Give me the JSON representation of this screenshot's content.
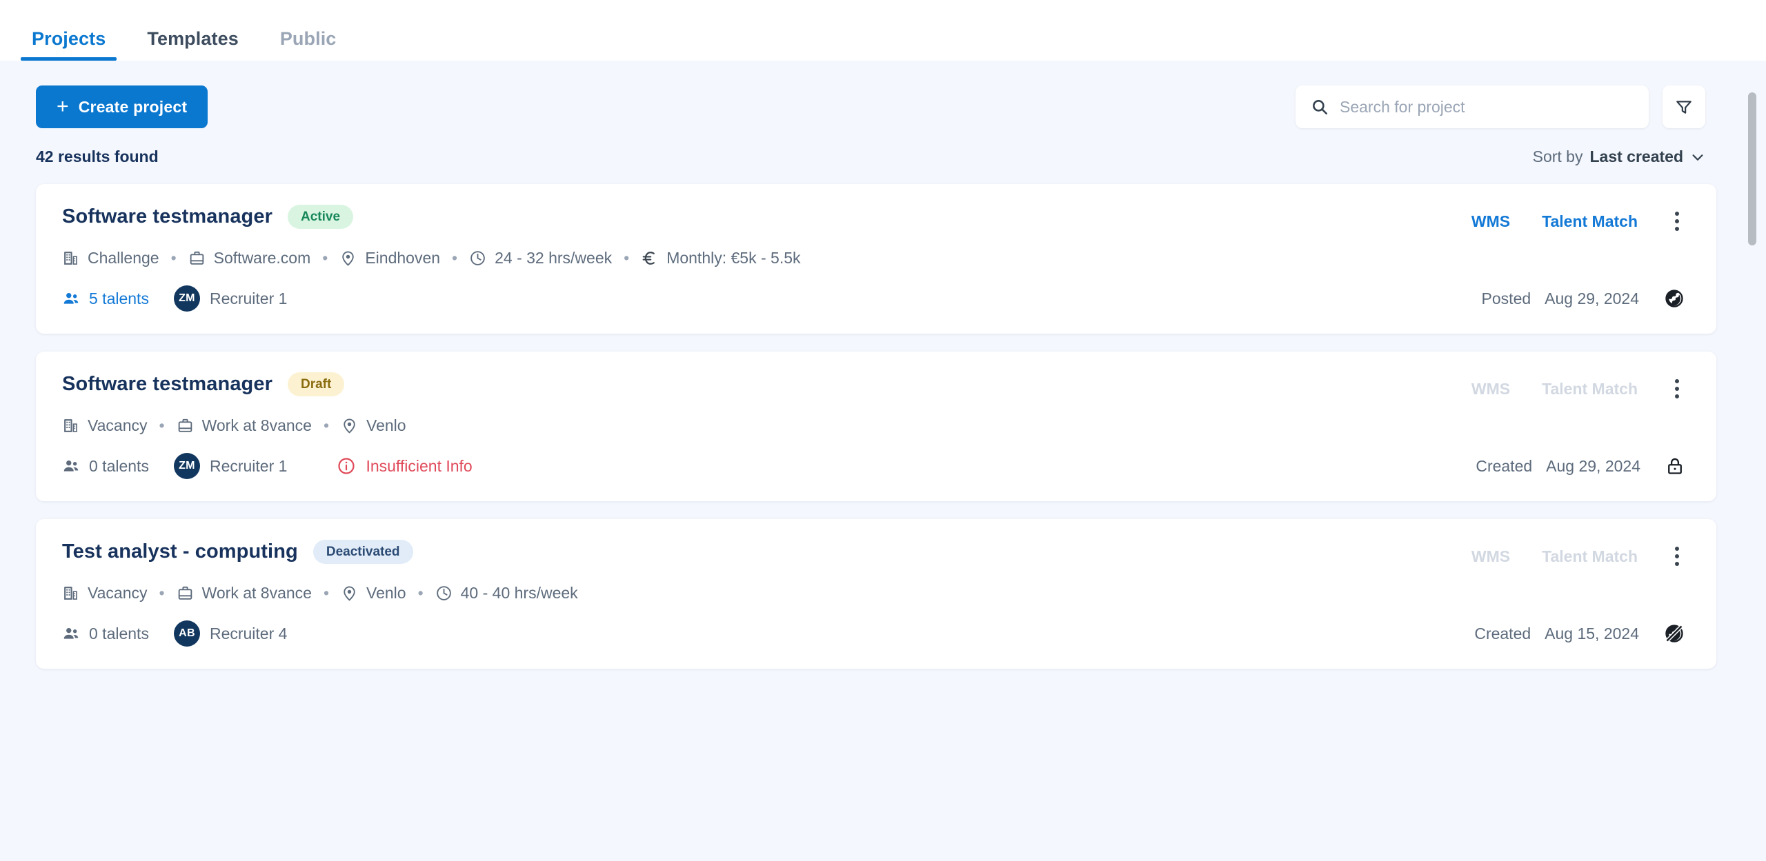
{
  "tabs": [
    {
      "label": "Projects",
      "state": "active"
    },
    {
      "label": "Templates",
      "state": "default"
    },
    {
      "label": "Public",
      "state": "muted"
    }
  ],
  "toolbar": {
    "create_label": "Create project",
    "create_plus": "+",
    "search_placeholder": "Search for project",
    "search_value": "",
    "search_icon": "search-icon",
    "filter_icon": "filter-icon"
  },
  "results": {
    "count_text": "42 results found",
    "sort_label": "Sort by",
    "sort_value": "Last created",
    "sort_chevron": "chevron-down-icon"
  },
  "cards": [
    {
      "title": "Software testmanager",
      "badge": {
        "text": "Active",
        "style": "active"
      },
      "actions": {
        "wms": "WMS",
        "talent_match": "Talent Match",
        "enabled": true
      },
      "meta": [
        {
          "icon": "building-icon",
          "text": "Challenge"
        },
        {
          "icon": "briefcase-icon",
          "text": "Software.com"
        },
        {
          "icon": "location-icon",
          "text": "Eindhoven"
        },
        {
          "icon": "clock-icon",
          "text": "24 - 32 hrs/week"
        },
        {
          "icon": "euro-icon",
          "text": "Monthly: €5k - 5.5k"
        }
      ],
      "talents": {
        "text": "5 talents",
        "has_talents": true
      },
      "recruiter": {
        "initials": "ZM",
        "name": "Recruiter 1"
      },
      "warning": null,
      "date_label": "Posted",
      "date_value": "Aug 29, 2024",
      "visibility_icon": "globe-icon"
    },
    {
      "title": "Software testmanager",
      "badge": {
        "text": "Draft",
        "style": "draft"
      },
      "actions": {
        "wms": "WMS",
        "talent_match": "Talent Match",
        "enabled": false
      },
      "meta": [
        {
          "icon": "building-icon",
          "text": "Vacancy"
        },
        {
          "icon": "briefcase-icon",
          "text": "Work at 8vance"
        },
        {
          "icon": "location-icon",
          "text": "Venlo"
        }
      ],
      "talents": {
        "text": "0 talents",
        "has_talents": false
      },
      "recruiter": {
        "initials": "ZM",
        "name": "Recruiter 1"
      },
      "warning": {
        "icon": "info-circle-icon",
        "text": "Insufficient Info"
      },
      "date_label": "Created",
      "date_value": "Aug 29, 2024",
      "visibility_icon": "lock-icon"
    },
    {
      "title": "Test analyst - computing",
      "badge": {
        "text": "Deactivated",
        "style": "deactivated"
      },
      "actions": {
        "wms": "WMS",
        "talent_match": "Talent Match",
        "enabled": false
      },
      "meta": [
        {
          "icon": "building-icon",
          "text": "Vacancy"
        },
        {
          "icon": "briefcase-icon",
          "text": "Work at 8vance"
        },
        {
          "icon": "location-icon",
          "text": "Venlo"
        },
        {
          "icon": "clock-icon",
          "text": "40 - 40 hrs/week"
        }
      ],
      "talents": {
        "text": "0 talents",
        "has_talents": false
      },
      "recruiter": {
        "initials": "AB",
        "name": "Recruiter 4"
      },
      "warning": null,
      "date_label": "Created",
      "date_value": "Aug 15, 2024",
      "visibility_icon": "globe-off-icon"
    }
  ],
  "separator": "•",
  "colors": {
    "accent_blue": "#0b78d0",
    "link_blue": "#1379d6",
    "title_navy": "#17325c",
    "page_bg": "#f4f7fd",
    "badge_active_bg": "#d9f5e2",
    "badge_active_fg": "#18875a",
    "badge_draft_bg": "#fcf2d2",
    "badge_draft_fg": "#8a6c10",
    "badge_deactivated_bg": "#e1ecf8",
    "badge_deactivated_fg": "#2b4a74",
    "warning_red": "#e04a5a"
  }
}
